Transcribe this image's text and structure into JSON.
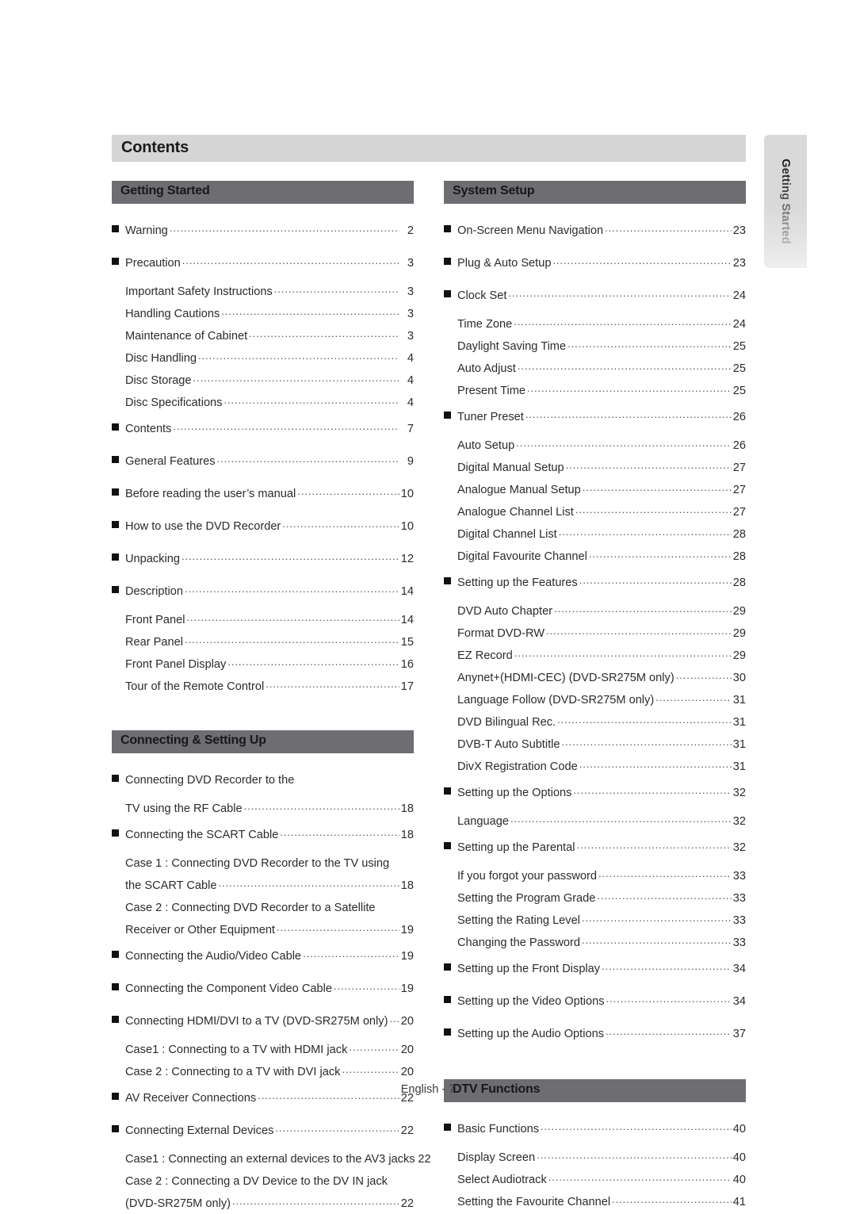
{
  "page": {
    "title": "Contents",
    "footer": "English - 7",
    "side_tab_label": "Getting Started",
    "colors": {
      "title_bar_bg": "#d5d5d6",
      "section_header_bg": "#6e6e72",
      "text": "#2b2b2e",
      "bullet": "#111114",
      "side_tab_bg": "#d9d9da"
    }
  },
  "columns": {
    "left": [
      {
        "heading": "Getting Started",
        "entries": [
          {
            "level": 1,
            "label": "Warning",
            "page": "2"
          },
          {
            "level": 1,
            "label": "Precaution",
            "page": "3"
          },
          {
            "level": 2,
            "label": "Important Safety Instructions",
            "page": "3"
          },
          {
            "level": 2,
            "label": "Handling Cautions",
            "page": "3"
          },
          {
            "level": 2,
            "label": "Maintenance of Cabinet",
            "page": "3"
          },
          {
            "level": 2,
            "label": "Disc Handling",
            "page": "4"
          },
          {
            "level": 2,
            "label": "Disc Storage",
            "page": "4"
          },
          {
            "level": 2,
            "label": "Disc Specifications",
            "page": "4"
          },
          {
            "level": 1,
            "label": "Contents",
            "page": "7"
          },
          {
            "level": 1,
            "label": "General Features",
            "page": "9"
          },
          {
            "level": 1,
            "label": "Before reading the user’s manual",
            "page": "10"
          },
          {
            "level": 1,
            "label": "How to use the DVD Recorder",
            "page": "10"
          },
          {
            "level": 1,
            "label": "Unpacking",
            "page": "12"
          },
          {
            "level": 1,
            "label": "Description",
            "page": "14"
          },
          {
            "level": 2,
            "label": "Front Panel",
            "page": "14"
          },
          {
            "level": 2,
            "label": "Rear Panel",
            "page": "15"
          },
          {
            "level": 2,
            "label": "Front Panel Display",
            "page": "16"
          },
          {
            "level": 2,
            "label": "Tour of the Remote Control",
            "page": "17"
          }
        ]
      },
      {
        "heading": "Connecting & Setting Up",
        "entries": [
          {
            "level": 1,
            "label": "Connecting DVD Recorder to the",
            "page": "",
            "leader": false
          },
          {
            "level": 0,
            "label": "TV using the RF Cable",
            "page": "18"
          },
          {
            "level": 1,
            "label": "Connecting the SCART Cable",
            "page": "18"
          },
          {
            "level": 2,
            "label": "Case 1 : Connecting DVD Recorder to the TV using",
            "page": "",
            "leader": false
          },
          {
            "level": 2,
            "label": "the SCART Cable",
            "page": "18"
          },
          {
            "level": 2,
            "label": "Case 2 : Connecting DVD Recorder to a Satellite",
            "page": "",
            "leader": false
          },
          {
            "level": 2,
            "label": "Receiver or Other Equipment",
            "page": "19"
          },
          {
            "level": 1,
            "label": "Connecting the Audio/Video Cable",
            "page": "19"
          },
          {
            "level": 1,
            "label": "Connecting the Component Video Cable",
            "page": "19"
          },
          {
            "level": 1,
            "label": "Connecting HDMI/DVI to a TV (DVD-SR275M only)",
            "page": "20"
          },
          {
            "level": 2,
            "label": "Case1 : Connecting to a TV with HDMI jack",
            "page": "20"
          },
          {
            "level": 2,
            "label": "Case 2 : Connecting to a TV with DVI jack",
            "page": "20"
          },
          {
            "level": 1,
            "label": "AV Receiver Connections",
            "page": "22"
          },
          {
            "level": 1,
            "label": "Connecting External Devices",
            "page": "22"
          },
          {
            "level": 2,
            "label": "Case1 : Connecting an external devices to the AV3 jacks",
            "page": "22"
          },
          {
            "level": 2,
            "label": "Case 2 : Connecting a DV Device to the DV IN jack",
            "page": "",
            "leader": false
          },
          {
            "level": 2,
            "label": "(DVD-SR275M only)",
            "page": "22"
          }
        ]
      }
    ],
    "right": [
      {
        "heading": "System Setup",
        "entries": [
          {
            "level": 1,
            "label": "On-Screen Menu Navigation",
            "page": "23"
          },
          {
            "level": 1,
            "label": "Plug & Auto Setup",
            "page": "23"
          },
          {
            "level": 1,
            "label": "Clock Set",
            "page": "24"
          },
          {
            "level": 2,
            "label": "Time Zone",
            "page": "24"
          },
          {
            "level": 2,
            "label": "Daylight Saving Time",
            "page": "25"
          },
          {
            "level": 2,
            "label": "Auto Adjust",
            "page": "25"
          },
          {
            "level": 2,
            "label": "Present Time",
            "page": "25"
          },
          {
            "level": 1,
            "label": "Tuner Preset",
            "page": "26"
          },
          {
            "level": 2,
            "label": "Auto Setup",
            "page": "26"
          },
          {
            "level": 2,
            "label": "Digital Manual Setup",
            "page": "27"
          },
          {
            "level": 2,
            "label": "Analogue Manual Setup",
            "page": "27"
          },
          {
            "level": 2,
            "label": "Analogue Channel List",
            "page": "27"
          },
          {
            "level": 2,
            "label": "Digital Channel List",
            "page": "28"
          },
          {
            "level": 2,
            "label": "Digital Favourite Channel",
            "page": "28"
          },
          {
            "level": 1,
            "label": "Setting up the Features",
            "page": "28"
          },
          {
            "level": 2,
            "label": "DVD Auto Chapter",
            "page": "29"
          },
          {
            "level": 2,
            "label": "Format DVD-RW",
            "page": "29"
          },
          {
            "level": 2,
            "label": "EZ Record",
            "page": "29"
          },
          {
            "level": 2,
            "label": "Anynet+(HDMI-CEC) (DVD-SR275M only)",
            "page": "30"
          },
          {
            "level": 2,
            "label": "Language Follow (DVD-SR275M only)",
            "page": "31"
          },
          {
            "level": 2,
            "label": "DVD Bilingual Rec.",
            "page": "31"
          },
          {
            "level": 2,
            "label": "DVB-T Auto Subtitle",
            "page": "31"
          },
          {
            "level": 2,
            "label": "DivX Registration Code",
            "page": "31"
          },
          {
            "level": 1,
            "label": "Setting up the Options",
            "page": "32"
          },
          {
            "level": 2,
            "label": "Language",
            "page": "32"
          },
          {
            "level": 1,
            "label": "Setting up the Parental",
            "page": "32"
          },
          {
            "level": 2,
            "label": "If you forgot your password",
            "page": "33"
          },
          {
            "level": 2,
            "label": "Setting the Program Grade",
            "page": "33"
          },
          {
            "level": 2,
            "label": "Setting the Rating Level",
            "page": "33"
          },
          {
            "level": 2,
            "label": "Changing the Password",
            "page": "33"
          },
          {
            "level": 1,
            "label": "Setting up the Front Display",
            "page": "34"
          },
          {
            "level": 1,
            "label": "Setting up the Video Options",
            "page": "34"
          },
          {
            "level": 1,
            "label": "Setting up the Audio Options",
            "page": "37"
          }
        ]
      },
      {
        "heading": "DTV Functions",
        "entries": [
          {
            "level": 1,
            "label": "Basic Functions",
            "page": "40"
          },
          {
            "level": 2,
            "label": "Display Screen",
            "page": "40"
          },
          {
            "level": 2,
            "label": "Select Audiotrack",
            "page": "40"
          },
          {
            "level": 2,
            "label": "Setting the Favourite Channel",
            "page": "41"
          }
        ]
      }
    ]
  }
}
